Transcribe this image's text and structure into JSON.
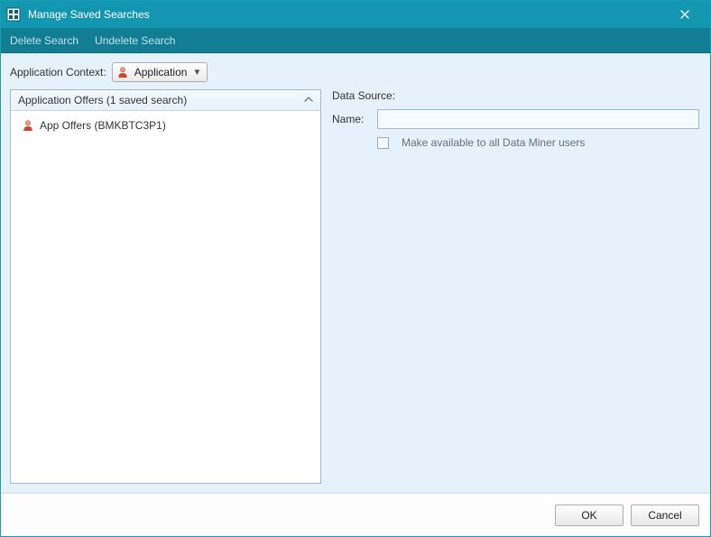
{
  "window": {
    "title": "Manage Saved Searches"
  },
  "toolbar": {
    "delete_label": "Delete Search",
    "undelete_label": "Undelete Search"
  },
  "context": {
    "label": "Application Context:",
    "selected": "Application"
  },
  "tree": {
    "header": "Application Offers (1 saved search)",
    "items": [
      {
        "label": "App Offers (BMKBTC3P1)"
      }
    ]
  },
  "form": {
    "data_source_label": "Data Source:",
    "data_source_value": "",
    "name_label": "Name:",
    "name_value": "",
    "share_label": "Make available to all Data Miner users",
    "share_checked": false
  },
  "footer": {
    "ok_label": "OK",
    "cancel_label": "Cancel"
  }
}
